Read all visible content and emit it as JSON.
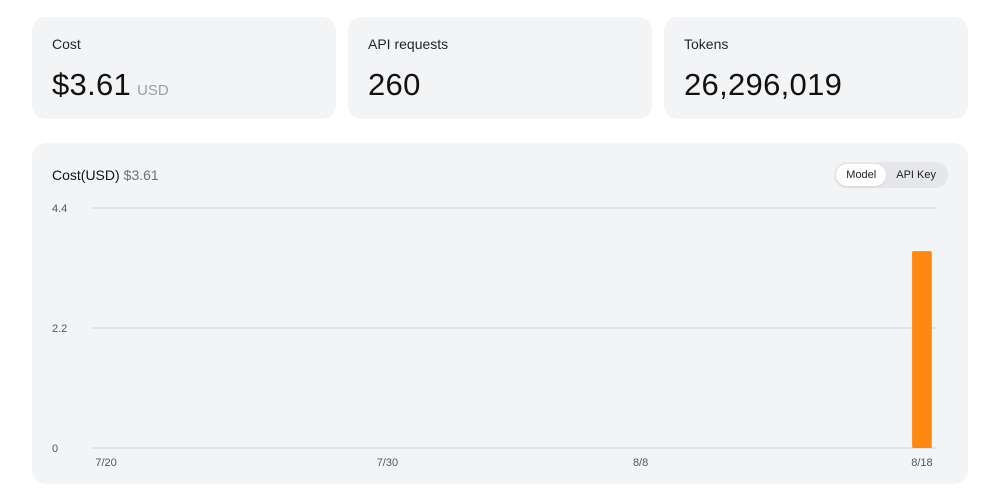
{
  "stats": {
    "cost": {
      "label": "Cost",
      "value": "$3.61",
      "unit": "USD"
    },
    "requests": {
      "label": "API requests",
      "value": "260"
    },
    "tokens": {
      "label": "Tokens",
      "value": "26,296,019"
    }
  },
  "chart": {
    "title": "Cost(USD)",
    "total": "$3.61",
    "group_by": {
      "options": [
        "Model",
        "API Key"
      ],
      "selected": "Model"
    }
  },
  "colors": {
    "bar": "#ff8811",
    "grid": "#d4d6da",
    "card": "#f3f4f6"
  },
  "chart_data": {
    "type": "bar",
    "title": "Cost(USD)",
    "xlabel": "",
    "ylabel": "",
    "ylim": [
      0,
      4.4
    ],
    "y_ticks": [
      "0",
      "2.2",
      "4.4"
    ],
    "x_tick_labels": [
      "7/20",
      "7/30",
      "8/8",
      "8/18"
    ],
    "categories": [
      "7/20",
      "7/21",
      "7/22",
      "7/23",
      "7/24",
      "7/25",
      "7/26",
      "7/27",
      "7/28",
      "7/29",
      "7/30",
      "7/31",
      "8/1",
      "8/2",
      "8/3",
      "8/4",
      "8/5",
      "8/6",
      "8/7",
      "8/8",
      "8/9",
      "8/10",
      "8/11",
      "8/12",
      "8/13",
      "8/14",
      "8/15",
      "8/16",
      "8/17",
      "8/18"
    ],
    "values": [
      0,
      0,
      0,
      0,
      0,
      0,
      0,
      0,
      0,
      0,
      0,
      0,
      0,
      0,
      0,
      0,
      0,
      0,
      0,
      0,
      0,
      0,
      0,
      0,
      0,
      0,
      0,
      0,
      0,
      3.61
    ],
    "grid": true
  }
}
